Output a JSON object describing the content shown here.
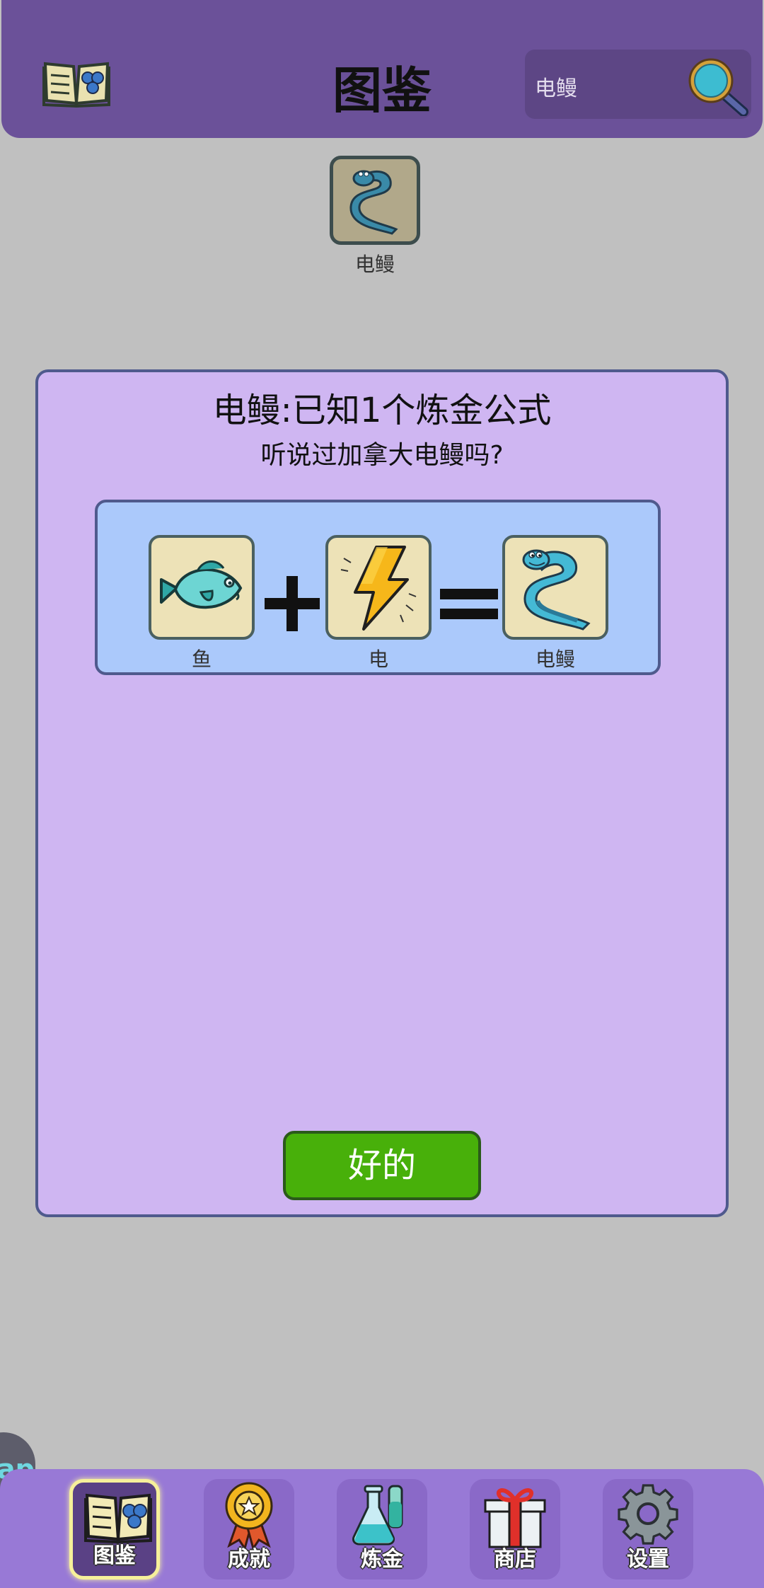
{
  "header": {
    "title": "图鉴",
    "search_value": "电鳗"
  },
  "result": {
    "label": "电鳗"
  },
  "dialog": {
    "title": "电鳗:已知1个炼金公式",
    "subtitle": "听说过加拿大电鳗吗?",
    "formula": {
      "input1": "鱼",
      "input2": "电",
      "output": "电鳗"
    },
    "ok_label": "好的"
  },
  "side_tab": {
    "text": "ap"
  },
  "nav": {
    "items": [
      {
        "label": "图鉴",
        "icon": "book-icon",
        "active": true
      },
      {
        "label": "成就",
        "icon": "medal-icon",
        "active": false
      },
      {
        "label": "炼金",
        "icon": "flask-icon",
        "active": false
      },
      {
        "label": "商店",
        "icon": "gift-icon",
        "active": false
      },
      {
        "label": "设置",
        "icon": "gear-icon",
        "active": false
      }
    ]
  },
  "colors": {
    "header_bg": "#6b5199",
    "dialog_bg": "#cfb6f2",
    "formula_bg": "#abc9fb",
    "ok_button": "#48b00a",
    "nav_bg": "#9879d6"
  }
}
